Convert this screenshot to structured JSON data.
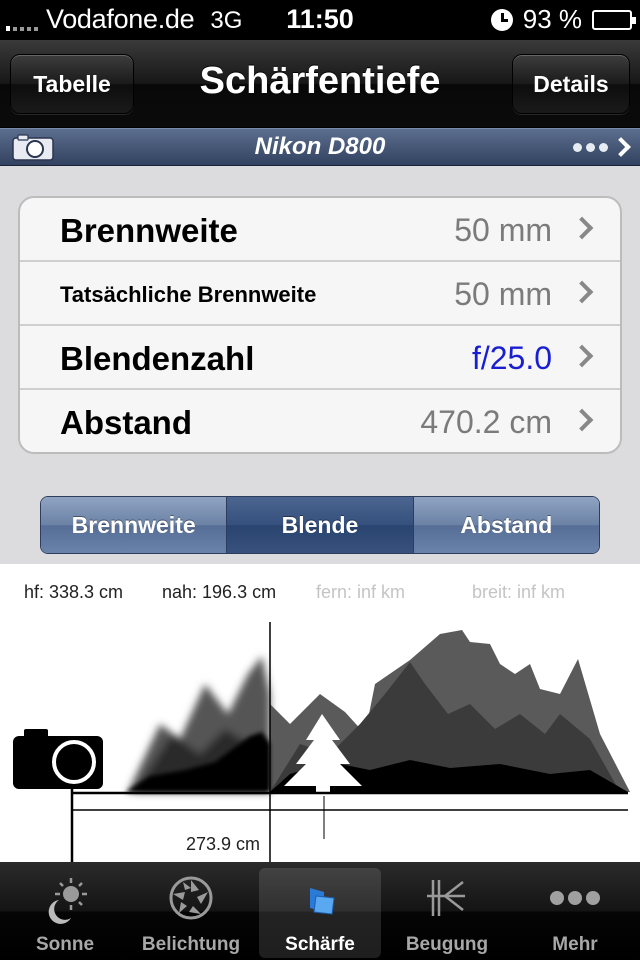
{
  "status_bar": {
    "carrier": "Vodafone.de",
    "network": "3G",
    "time": "11:50",
    "battery": "93 %"
  },
  "nav": {
    "left_button": "Tabelle",
    "title": "Schärfentiefe",
    "right_button": "Details"
  },
  "camera": {
    "name": "Nikon D800"
  },
  "settings": {
    "rows": [
      {
        "label": "Brennweite",
        "value": "50 mm"
      },
      {
        "label": "Tatsächliche Brennweite",
        "value": "50 mm"
      },
      {
        "label": "Blendenzahl",
        "value": "f/25.0"
      },
      {
        "label": "Abstand",
        "value": "470.2 cm"
      }
    ]
  },
  "segments": [
    "Brennweite",
    "Blende",
    "Abstand"
  ],
  "selected_segment": "Blende",
  "diagram": {
    "hf": "hf: 338.3 cm",
    "nah": "nah: 196.3 cm",
    "fern": "fern: inf km",
    "breit": "breit: inf km",
    "distance": "273.9 cm"
  },
  "tabs": [
    {
      "label": "Sonne",
      "icon": "sun-moon-icon"
    },
    {
      "label": "Belichtung",
      "icon": "aperture-icon"
    },
    {
      "label": "Schärfe",
      "icon": "focus-planes-icon"
    },
    {
      "label": "Beugung",
      "icon": "diffraction-icon"
    },
    {
      "label": "Mehr",
      "icon": "more-dots-icon"
    }
  ],
  "active_tab": "Schärfe",
  "colors": {
    "accent_blue_value": "#1a1ed2",
    "segment_selected": "#35507d"
  }
}
